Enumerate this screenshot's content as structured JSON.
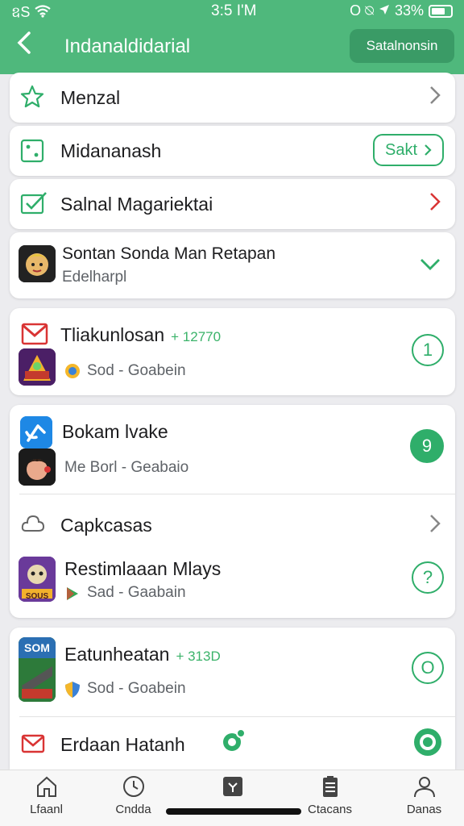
{
  "status": {
    "left": "ឧS",
    "time": "3:5 I'M",
    "right": "O ⍉",
    "battery": "33%"
  },
  "header": {
    "title": "Indanaldidarial",
    "action": "Satalnonsin"
  },
  "menu": [
    {
      "label": "Menzal",
      "icon": "star-icon"
    },
    {
      "label": "Midananash",
      "icon": "dice-icon",
      "action": "Sakt"
    },
    {
      "label": "Salnal Magariektai",
      "icon": "check-mail-icon"
    },
    {
      "label": "Sontan Sonda Man Retapan",
      "sub": "Edelharpl",
      "icon": "avatar-icon"
    }
  ],
  "feed": [
    {
      "title": "Tliakunlosan",
      "badge": "+ 12770",
      "sub": "Sod - Goabein",
      "circle": "1"
    },
    {
      "title": "Bokam lvake",
      "sub": "Me Borl - Geabaio",
      "circle": "9"
    },
    {
      "title": "Capkcasas"
    },
    {
      "title": "Restimlaaan Mlays",
      "sub": "Sad - Gaabain",
      "circle": "?",
      "app_text": "SOUS"
    },
    {
      "title": "Eatunheatan",
      "badge": "+ 313D",
      "sub": "Sod - Goabein",
      "circle": "O",
      "app_text": "SOM"
    },
    {
      "title": "Erdaan Hatanh"
    }
  ],
  "tabs": [
    {
      "label": "Lfaanl",
      "icon": "home-icon"
    },
    {
      "label": "Cndda",
      "icon": "clock-icon"
    },
    {
      "label": "",
      "icon": "grid-icon"
    },
    {
      "label": "Ctacans",
      "icon": "clipboard-icon"
    },
    {
      "label": "Danas",
      "icon": "person-icon"
    }
  ],
  "colors": {
    "accent": "#4fb87c",
    "accent_dark": "#3a9b66",
    "red": "#d93434"
  }
}
